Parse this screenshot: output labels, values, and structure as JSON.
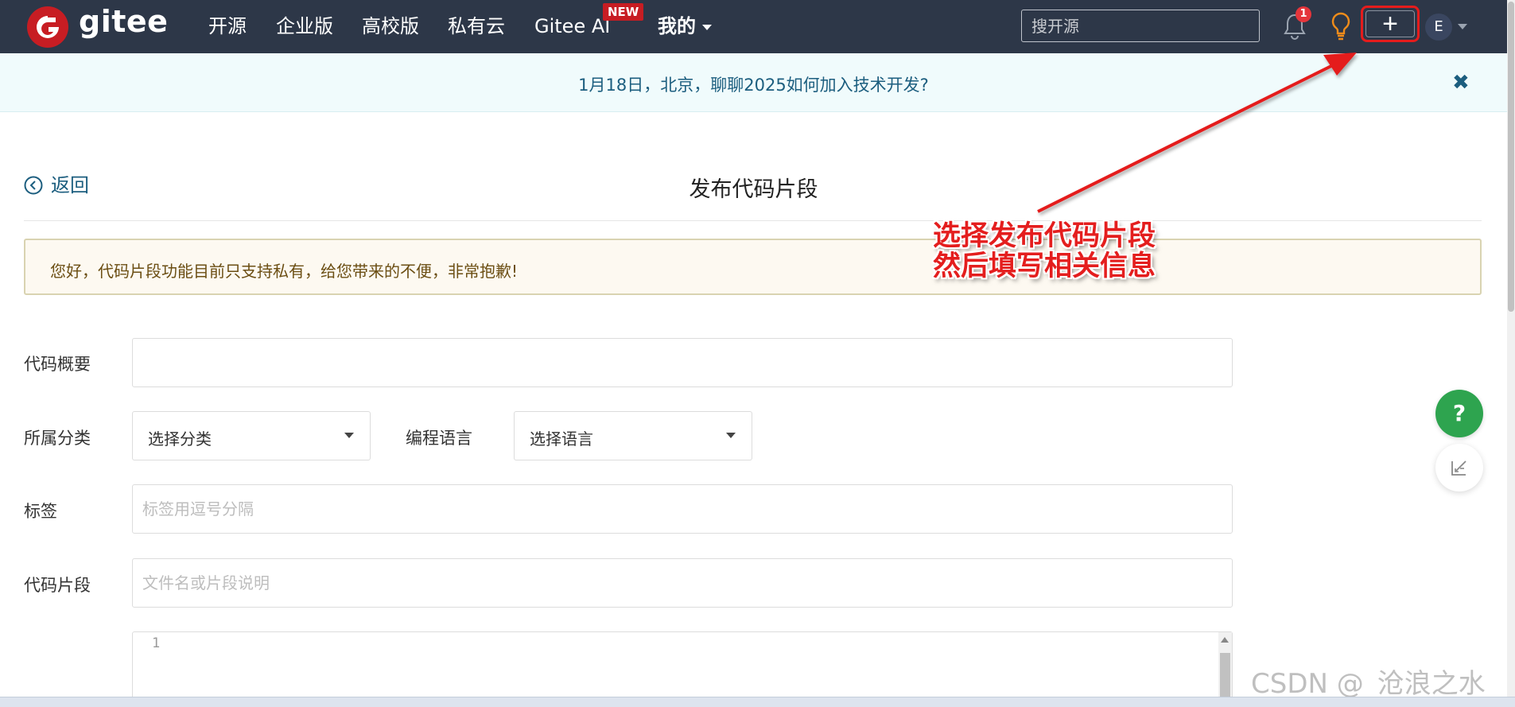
{
  "navbar": {
    "brand": "gitee",
    "items": [
      {
        "label": "开源"
      },
      {
        "label": "企业版"
      },
      {
        "label": "高校版"
      },
      {
        "label": "私有云"
      },
      {
        "label": "Gitee AI"
      },
      {
        "label": "我的"
      }
    ],
    "new_badge": "NEW",
    "search_placeholder": "搜开源",
    "notification_count": "1",
    "create_label": "+",
    "avatar_letter": "E",
    "bg_color": "#2d3748",
    "brand_color": "#c71d23"
  },
  "announcement": {
    "text": "1月18日，北京，聊聊2025如何加入技术开发?",
    "close_label": "✖"
  },
  "page": {
    "back_label": "返回",
    "title": "发布代码片段",
    "notice": "您好，代码片段功能目前只支持私有，给您带来的不便，非常抱歉!"
  },
  "form": {
    "summary_label": "代码概要",
    "summary_value": "",
    "category_label": "所属分类",
    "category_value": "选择分类",
    "language_label": "编程语言",
    "language_value": "选择语言",
    "tags_label": "标签",
    "tags_placeholder": "标签用逗号分隔",
    "snippet_label": "代码片段",
    "snippet_placeholder": "文件名或片段说明",
    "editor_line": "1"
  },
  "floating": {
    "help_label": "?"
  },
  "annotation": {
    "line1": "选择发布代码片段",
    "line2": "然后填写相关信息",
    "color": "#e41e1e"
  },
  "watermark": "CSDN @_沧浪之水_"
}
